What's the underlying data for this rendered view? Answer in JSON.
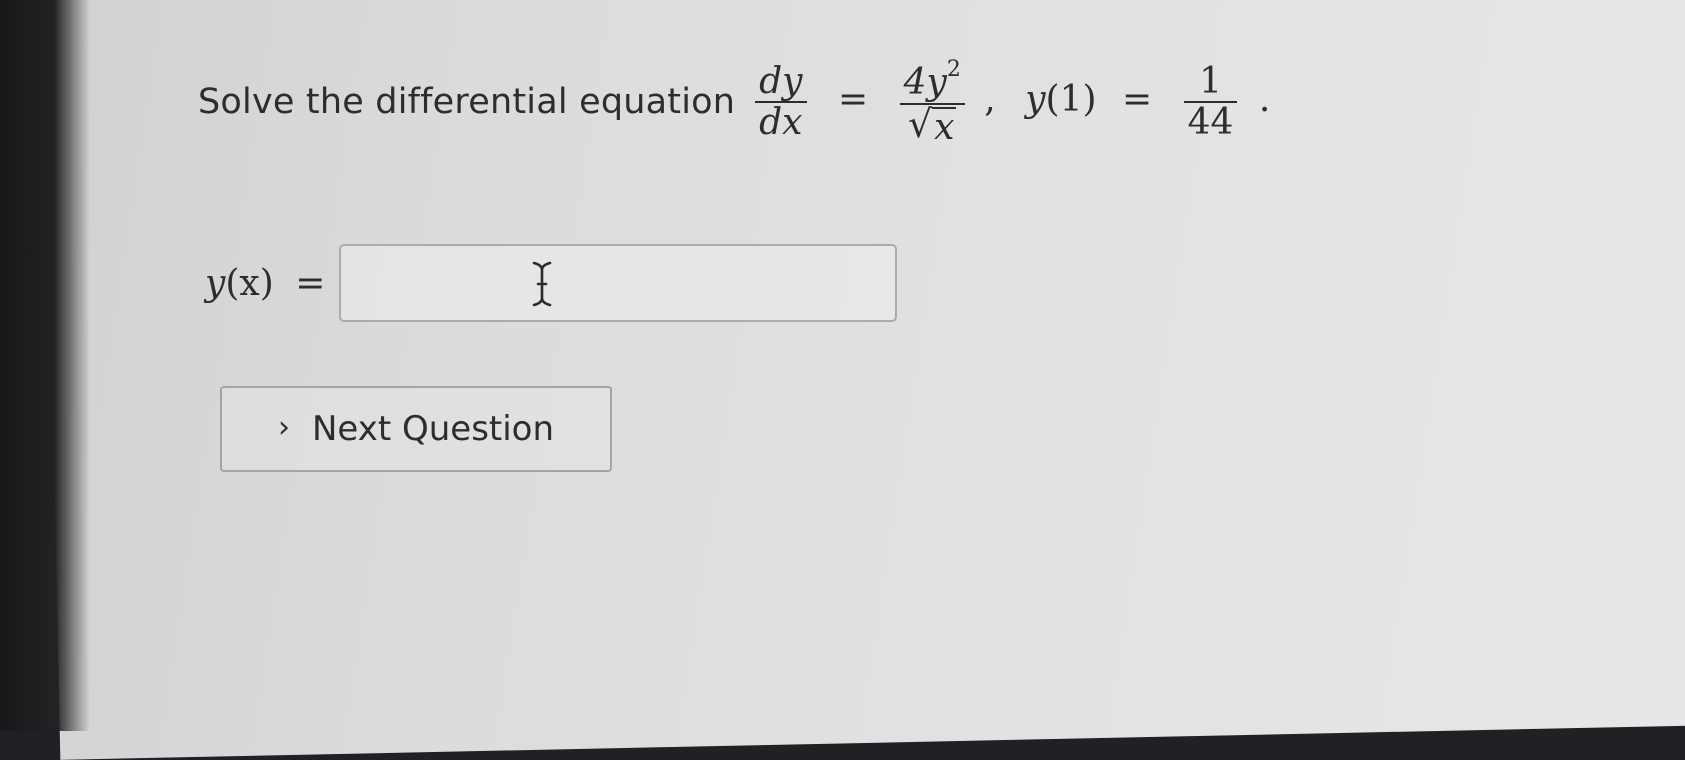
{
  "question": {
    "prompt": "Solve the differential equation",
    "lhs_num": "dy",
    "lhs_den": "dx",
    "equals": "=",
    "rhs_num_coeff": "4y",
    "rhs_num_exp": "2",
    "rhs_den_radicand": "x",
    "ic_func": "y",
    "ic_arg": "(1)",
    "ic_equals": "=",
    "ic_num": "1",
    "ic_den": "44"
  },
  "answer": {
    "label_func": "y",
    "label_arg": "(x)",
    "label_equals": "=",
    "value": "",
    "placeholder": ""
  },
  "navigation": {
    "next_label": "Next Question",
    "next_icon": "chevron-right-icon"
  },
  "cursor": {
    "icon": "text-cursor-icon"
  }
}
